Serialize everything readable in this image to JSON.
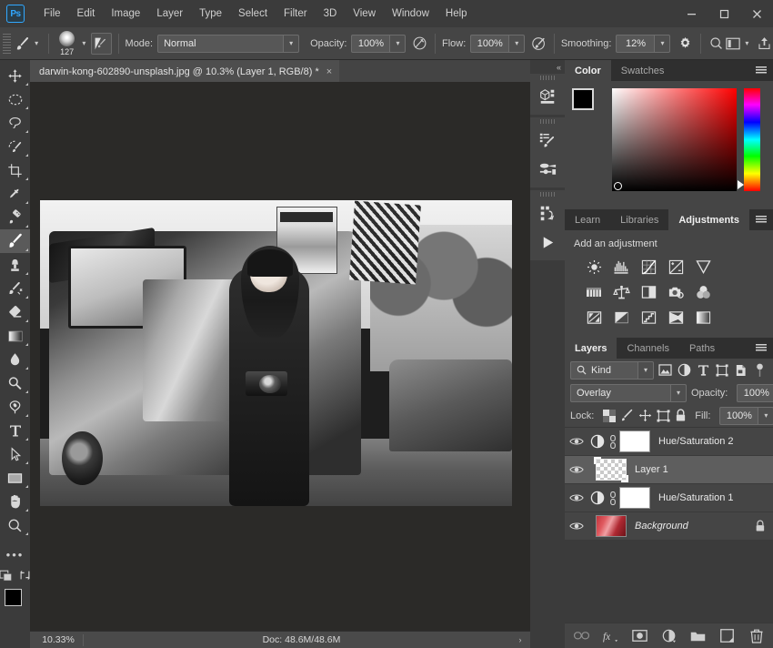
{
  "app": {
    "logo": "Ps",
    "menus": [
      "File",
      "Edit",
      "Image",
      "Layer",
      "Type",
      "Select",
      "Filter",
      "3D",
      "View",
      "Window",
      "Help"
    ],
    "window_controls": {
      "minimize": "—",
      "maximize": "□",
      "close": "✕"
    }
  },
  "options_bar": {
    "brush_size": "127",
    "mode_label": "Mode:",
    "mode_value": "Normal",
    "opacity_label": "Opacity:",
    "opacity_value": "100%",
    "flow_label": "Flow:",
    "flow_value": "100%",
    "smoothing_label": "Smoothing:",
    "smoothing_value": "12%"
  },
  "toolbar": {
    "tools": [
      {
        "name": "move-tool",
        "active": false
      },
      {
        "name": "marquee-tool",
        "active": false
      },
      {
        "name": "lasso-tool",
        "active": false
      },
      {
        "name": "quick-selection-tool",
        "active": false
      },
      {
        "name": "crop-tool",
        "active": false
      },
      {
        "name": "eyedropper-tool",
        "active": false
      },
      {
        "name": "healing-brush-tool",
        "active": false
      },
      {
        "name": "brush-tool",
        "active": true
      },
      {
        "name": "clone-stamp-tool",
        "active": false
      },
      {
        "name": "history-brush-tool",
        "active": false
      },
      {
        "name": "eraser-tool",
        "active": false
      },
      {
        "name": "gradient-tool",
        "active": false
      },
      {
        "name": "blur-tool",
        "active": false
      },
      {
        "name": "dodge-tool",
        "active": false
      },
      {
        "name": "pen-tool",
        "active": false
      },
      {
        "name": "type-tool",
        "active": false
      },
      {
        "name": "path-selection-tool",
        "active": false
      },
      {
        "name": "rectangle-tool",
        "active": false
      },
      {
        "name": "hand-tool",
        "active": false
      },
      {
        "name": "zoom-tool",
        "active": false
      }
    ],
    "more_tools": "•••",
    "foreground_color": "#000000",
    "background_color": "#ffffff"
  },
  "document": {
    "tab_title": "darwin-kong-602890-unsplash.jpg @ 10.3% (Layer 1, RGB/8) *",
    "close_label": "×"
  },
  "status_bar": {
    "zoom": "10.33%",
    "doc_info": "Doc: 48.6M/48.6M",
    "expand_arrow": "›"
  },
  "color_panel": {
    "tabs": [
      {
        "label": "Color",
        "active": true
      },
      {
        "label": "Swatches",
        "active": false
      }
    ],
    "foreground": "#000000",
    "background": "#ffffff"
  },
  "adjustments_panel": {
    "tabs": [
      {
        "label": "Learn",
        "active": false
      },
      {
        "label": "Libraries",
        "active": false
      },
      {
        "label": "Adjustments",
        "active": true
      }
    ],
    "heading": "Add an adjustment",
    "rows": [
      [
        "brightness-contrast-icon",
        "levels-icon",
        "curves-icon",
        "exposure-icon",
        "vibrance-icon"
      ],
      [
        "hue-saturation-icon",
        "color-balance-icon",
        "black-white-icon",
        "photo-filter-icon",
        "channel-mixer-icon"
      ],
      [
        "color-lookup-icon",
        "invert-icon",
        "posterize-icon",
        "threshold-icon",
        "gradient-map-icon"
      ]
    ]
  },
  "layers_panel": {
    "tabs": [
      {
        "label": "Layers",
        "active": true
      },
      {
        "label": "Channels",
        "active": false
      },
      {
        "label": "Paths",
        "active": false
      }
    ],
    "filter_label": "Kind",
    "filter_icons": [
      "pixel-layer-filter-icon",
      "adjustment-layer-filter-icon",
      "type-layer-filter-icon",
      "shape-layer-filter-icon",
      "smart-object-filter-icon"
    ],
    "blend_mode": "Overlay",
    "opacity_label": "Opacity:",
    "opacity_value": "100%",
    "lock_label": "Lock:",
    "lock_icons": [
      "lock-transparency-icon",
      "lock-image-icon",
      "lock-position-icon",
      "lock-artboard-icon",
      "lock-all-icon"
    ],
    "fill_label": "Fill:",
    "fill_value": "100%",
    "layers": [
      {
        "name": "Hue/Saturation 2",
        "type": "adjustment",
        "visible": true,
        "selected": false,
        "locked": false,
        "italic": false
      },
      {
        "name": "Layer 1",
        "type": "pixel-transparent",
        "visible": true,
        "selected": true,
        "locked": false,
        "italic": false
      },
      {
        "name": "Hue/Saturation 1",
        "type": "adjustment",
        "visible": true,
        "selected": false,
        "locked": false,
        "italic": false
      },
      {
        "name": "Background",
        "type": "photo",
        "visible": true,
        "selected": false,
        "locked": true,
        "italic": true
      }
    ],
    "bottom_buttons": [
      "link-layers-icon",
      "layer-style-icon",
      "layer-mask-icon",
      "new-adjustment-layer-icon",
      "new-group-icon",
      "new-layer-icon",
      "delete-layer-icon"
    ],
    "fx_label": "fx"
  },
  "dock_rail": {
    "collapse": "«",
    "buttons": [
      "3d-panel-icon",
      "brush-settings-icon",
      "brush-presets-icon",
      "actions-panel-icon",
      "play-action-icon"
    ]
  },
  "colors": {
    "accent": "#31a8ff",
    "panel_bg": "#454545",
    "chrome_bg": "#3b3b3b",
    "canvas_bg": "#2b2a28",
    "selected_row": "#5e5e5e"
  }
}
